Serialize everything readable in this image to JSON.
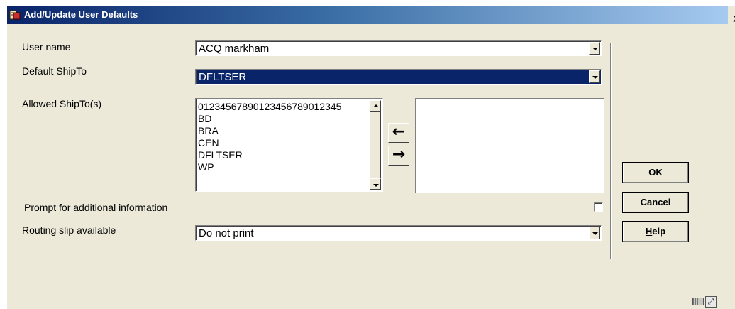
{
  "window": {
    "title": "Add/Update User Defaults",
    "close_glyph": "x"
  },
  "form": {
    "user_name": {
      "label": "User name",
      "value": "ACQ markham"
    },
    "default_shipto": {
      "label": "Default ShipTo",
      "value": "DFLTSER"
    },
    "allowed_shipto": {
      "label": "Allowed ShipTo(s)",
      "available": [
        "01234567890123456789012345",
        "BD",
        "BRA",
        "CEN",
        "DFLTSER",
        "WP"
      ],
      "selected": []
    },
    "prompt_additional": {
      "label_accel": "P",
      "label_rest": "rompt for additional information",
      "checked": false
    },
    "routing_slip": {
      "label": "Routing slip available",
      "value": "Do not print"
    }
  },
  "transfer": {
    "left_glyph": "←",
    "right_glyph": "→"
  },
  "buttons": {
    "ok": "OK",
    "cancel": "Cancel",
    "help_accel": "H",
    "help_rest": "elp"
  },
  "icons": {
    "title_icon": "app-icon",
    "keyboard_icon": "keyboard-icon",
    "resize_icon": "resize-icon",
    "resize_glyph": "⤢"
  }
}
